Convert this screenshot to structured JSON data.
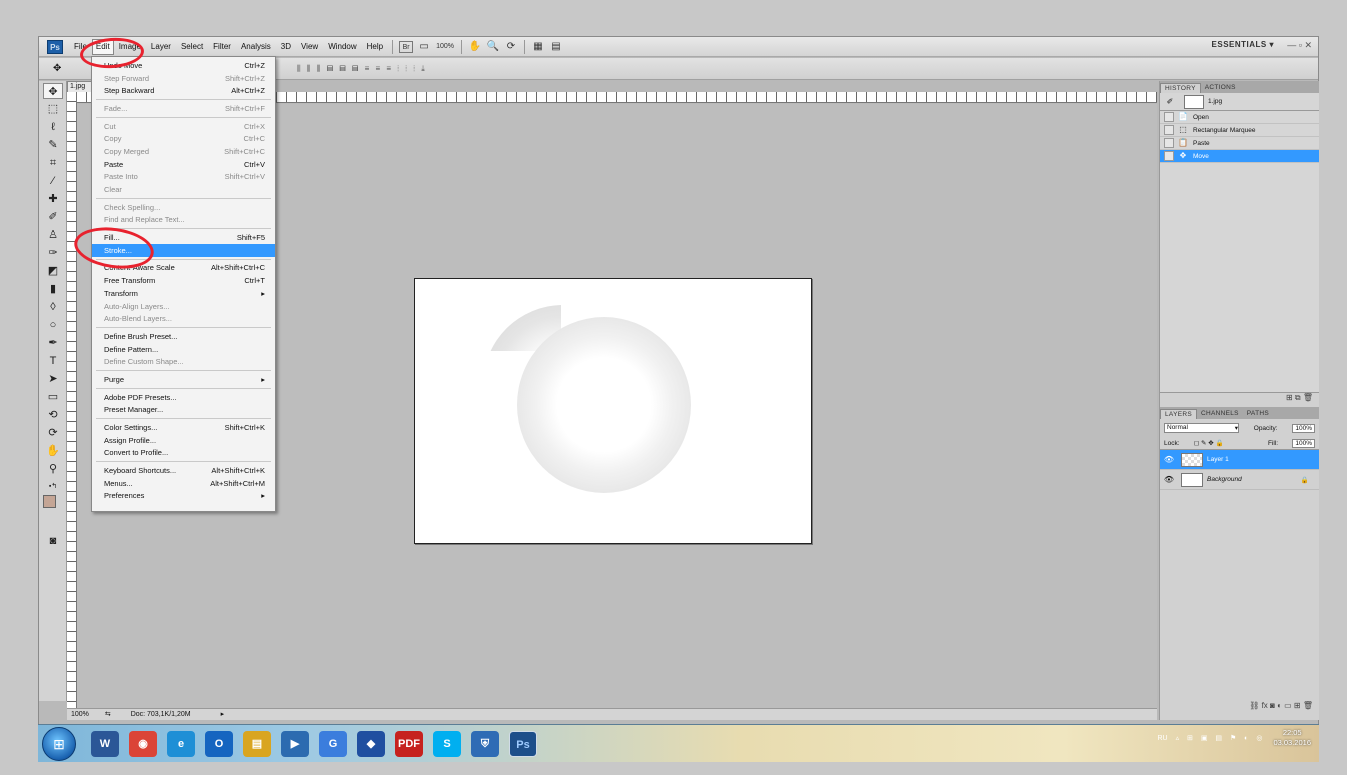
{
  "app": {
    "logo": "Ps",
    "workspace": "ESSENTIALS ▾",
    "window_controls": "—  ▫  ✕"
  },
  "menubar": {
    "items": [
      "File",
      "Edit",
      "Image",
      "Layer",
      "Select",
      "Filter",
      "Analysis",
      "3D",
      "View",
      "Window",
      "Help"
    ],
    "bridge": "Br",
    "zoom": "100%"
  },
  "edit_menu": {
    "groups": [
      [
        {
          "label": "Undo Move",
          "shortcut": "Ctrl+Z",
          "disabled": false
        },
        {
          "label": "Step Forward",
          "shortcut": "Shift+Ctrl+Z",
          "disabled": true
        },
        {
          "label": "Step Backward",
          "shortcut": "Alt+Ctrl+Z",
          "disabled": false
        }
      ],
      [
        {
          "label": "Fade...",
          "shortcut": "Shift+Ctrl+F",
          "disabled": true
        }
      ],
      [
        {
          "label": "Cut",
          "shortcut": "Ctrl+X",
          "disabled": true
        },
        {
          "label": "Copy",
          "shortcut": "Ctrl+C",
          "disabled": true
        },
        {
          "label": "Copy Merged",
          "shortcut": "Shift+Ctrl+C",
          "disabled": true
        },
        {
          "label": "Paste",
          "shortcut": "Ctrl+V",
          "disabled": false
        },
        {
          "label": "Paste Into",
          "shortcut": "Shift+Ctrl+V",
          "disabled": true
        },
        {
          "label": "Clear",
          "shortcut": "",
          "disabled": true
        }
      ],
      [
        {
          "label": "Check Spelling...",
          "shortcut": "",
          "disabled": true
        },
        {
          "label": "Find and Replace Text...",
          "shortcut": "",
          "disabled": true
        }
      ],
      [
        {
          "label": "Fill...",
          "shortcut": "Shift+F5",
          "disabled": false
        },
        {
          "label": "Stroke...",
          "shortcut": "",
          "disabled": false,
          "selected": true
        }
      ],
      [
        {
          "label": "Content-Aware Scale",
          "shortcut": "Alt+Shift+Ctrl+C",
          "disabled": false
        },
        {
          "label": "Free Transform",
          "shortcut": "Ctrl+T",
          "disabled": false
        },
        {
          "label": "Transform",
          "shortcut": "▸",
          "disabled": false
        },
        {
          "label": "Auto-Align Layers...",
          "shortcut": "",
          "disabled": true
        },
        {
          "label": "Auto-Blend Layers...",
          "shortcut": "",
          "disabled": true
        }
      ],
      [
        {
          "label": "Define Brush Preset...",
          "shortcut": "",
          "disabled": false
        },
        {
          "label": "Define Pattern...",
          "shortcut": "",
          "disabled": false
        },
        {
          "label": "Define Custom Shape...",
          "shortcut": "",
          "disabled": true
        }
      ],
      [
        {
          "label": "Purge",
          "shortcut": "▸",
          "disabled": false
        }
      ],
      [
        {
          "label": "Adobe PDF Presets...",
          "shortcut": "",
          "disabled": false
        },
        {
          "label": "Preset Manager...",
          "shortcut": "",
          "disabled": false
        }
      ],
      [
        {
          "label": "Color Settings...",
          "shortcut": "Shift+Ctrl+K",
          "disabled": false
        },
        {
          "label": "Assign Profile...",
          "shortcut": "",
          "disabled": false
        },
        {
          "label": "Convert to Profile...",
          "shortcut": "",
          "disabled": false
        }
      ],
      [
        {
          "label": "Keyboard Shortcuts...",
          "shortcut": "Alt+Shift+Ctrl+K",
          "disabled": false
        },
        {
          "label": "Menus...",
          "shortcut": "Alt+Shift+Ctrl+M",
          "disabled": false
        },
        {
          "label": "Preferences",
          "shortcut": "▸",
          "disabled": false
        }
      ]
    ]
  },
  "document": {
    "tab": "1.jpg"
  },
  "status": {
    "zoom": "100%",
    "doc_info": "Doc: 703,1K/1,20M"
  },
  "history": {
    "tabs": [
      "HISTORY",
      "ACTIONS"
    ],
    "snapshot": "1.jpg",
    "steps": [
      {
        "label": "Open",
        "icon": "📄",
        "selected": false
      },
      {
        "label": "Rectangular Marquee",
        "icon": "⬚",
        "selected": false
      },
      {
        "label": "Paste",
        "icon": "📋",
        "selected": false
      },
      {
        "label": "Move",
        "icon": "✥",
        "selected": true
      }
    ]
  },
  "layers": {
    "tabs": [
      "LAYERS",
      "CHANNELS",
      "PATHS"
    ],
    "blend_mode": "Normal",
    "opacity_label": "Opacity:",
    "opacity": "100%",
    "lock_label": "Lock:",
    "fill_label": "Fill:",
    "fill": "100%",
    "items": [
      {
        "name": "Layer 1",
        "selected": true,
        "locked": false
      },
      {
        "name": "Background",
        "selected": false,
        "locked": true
      }
    ]
  },
  "taskbar": {
    "apps": [
      {
        "name": "word",
        "label": "W",
        "color": "#2b5797"
      },
      {
        "name": "chrome",
        "label": "◉",
        "color": "#db4437"
      },
      {
        "name": "ie",
        "label": "e",
        "color": "#1e8fd6"
      },
      {
        "name": "outlook",
        "label": "O",
        "color": "#1565c0"
      },
      {
        "name": "explorer",
        "label": "▤",
        "color": "#d9a520"
      },
      {
        "name": "media-player",
        "label": "▶",
        "color": "#2c6bb0"
      },
      {
        "name": "app-blue",
        "label": "G",
        "color": "#3b7ddd"
      },
      {
        "name": "app-dark-blue",
        "label": "◆",
        "color": "#1f4fa0"
      },
      {
        "name": "pdf",
        "label": "PDF",
        "color": "#c6221f"
      },
      {
        "name": "skype",
        "label": "S",
        "color": "#00aff0"
      },
      {
        "name": "shield",
        "label": "⛨",
        "color": "#2f6cb5"
      },
      {
        "name": "photoshop",
        "label": "Ps",
        "color": "#1d4f8a",
        "open": true
      }
    ],
    "tray": {
      "lang": "RU",
      "time": "22:05",
      "date": "03.03.2016"
    }
  }
}
